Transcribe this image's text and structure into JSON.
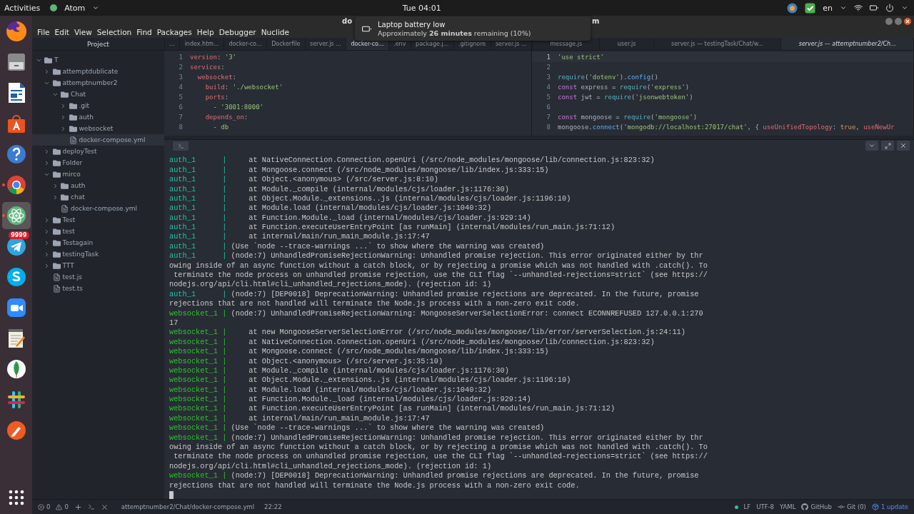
{
  "top_bar": {
    "activities": "Activities",
    "app_menu": "Atom",
    "clock": "Tue 04:01",
    "language": "en"
  },
  "dock": [
    {
      "kind": "firefox",
      "selected": false,
      "running": false
    },
    {
      "kind": "files",
      "selected": false,
      "running": false
    },
    {
      "kind": "writer",
      "selected": false,
      "running": false
    },
    {
      "kind": "store",
      "selected": false,
      "running": false
    },
    {
      "kind": "help",
      "selected": false,
      "running": false
    },
    {
      "kind": "chrome",
      "selected": false,
      "running": true
    },
    {
      "kind": "atom",
      "selected": true,
      "running": true
    },
    {
      "kind": "telegram",
      "selected": false,
      "running": false,
      "badge": "9999"
    },
    {
      "kind": "skype",
      "selected": false,
      "running": false
    },
    {
      "kind": "zoom",
      "selected": false,
      "running": false
    },
    {
      "kind": "notes",
      "selected": false,
      "running": false
    },
    {
      "kind": "leaf",
      "selected": false,
      "running": false
    },
    {
      "kind": "slack",
      "selected": false,
      "running": false
    },
    {
      "kind": "pen",
      "selected": false,
      "running": false
    }
  ],
  "notification": {
    "title": "Laptop battery low",
    "body": "Approximately **26 minutes** remaining (10%)"
  },
  "window": {
    "title_left": "do",
    "title_right": "m"
  },
  "menu": [
    "File",
    "Edit",
    "View",
    "Selection",
    "Find",
    "Packages",
    "Help",
    "Debugger",
    "Nuclide"
  ],
  "tree": {
    "header": "Project",
    "items": [
      {
        "label": "T",
        "kind": "folder",
        "expanded": true,
        "selected": false,
        "children": [
          {
            "label": "attemptdublicate",
            "kind": "folder",
            "expanded": false,
            "selected": false
          },
          {
            "label": "attemptnumber2",
            "kind": "folder",
            "expanded": true,
            "selected": false,
            "children": [
              {
                "label": "Chat",
                "kind": "folder",
                "expanded": true,
                "selected": false,
                "children": [
                  {
                    "label": ".git",
                    "kind": "folder",
                    "expanded": false,
                    "selected": false
                  },
                  {
                    "label": "auth",
                    "kind": "folder",
                    "expanded": false,
                    "selected": false
                  },
                  {
                    "label": "websocket",
                    "kind": "folder",
                    "expanded": false,
                    "selected": false
                  },
                  {
                    "label": "docker-compose.yml",
                    "kind": "file",
                    "selected": true
                  }
                ]
              }
            ]
          },
          {
            "label": "deployTest",
            "kind": "folder",
            "expanded": false,
            "selected": false
          },
          {
            "label": "Folder",
            "kind": "folder",
            "expanded": false,
            "selected": false
          },
          {
            "label": "mirco",
            "kind": "folder",
            "expanded": true,
            "selected": false,
            "children": [
              {
                "label": "auth",
                "kind": "folder",
                "expanded": false,
                "selected": false
              },
              {
                "label": "chat",
                "kind": "folder",
                "expanded": false,
                "selected": false
              },
              {
                "label": "docker-compose.yml",
                "kind": "file",
                "selected": false
              }
            ]
          },
          {
            "label": "Test",
            "kind": "folder",
            "expanded": false,
            "selected": false
          },
          {
            "label": "test",
            "kind": "folder",
            "expanded": false,
            "selected": false
          },
          {
            "label": "Testagain",
            "kind": "folder",
            "expanded": false,
            "selected": false
          },
          {
            "label": "testingTask",
            "kind": "folder",
            "expanded": false,
            "selected": false
          },
          {
            "label": "TTT",
            "kind": "folder",
            "expanded": false,
            "selected": false
          },
          {
            "label": "test.js",
            "kind": "file",
            "selected": false
          },
          {
            "label": "test.ts",
            "kind": "file",
            "selected": false
          }
        ]
      }
    ]
  },
  "panes": [
    {
      "tabs": [
        {
          "label": "...",
          "selected": false,
          "preview": false
        },
        {
          "label": "index.htm...",
          "selected": false,
          "preview": false
        },
        {
          "label": "docker-co...",
          "selected": false,
          "preview": false
        },
        {
          "label": "Dockerfile",
          "selected": false,
          "preview": false
        },
        {
          "label": "server.js ...",
          "selected": false,
          "preview": false
        },
        {
          "label": "docker-co...",
          "selected": true,
          "preview": false
        },
        {
          "label": ".env",
          "selected": false,
          "preview": false
        },
        {
          "label": "package.j...",
          "selected": false,
          "preview": false
        },
        {
          "label": ".gitignore",
          "selected": false,
          "preview": false
        },
        {
          "label": "server.js ...",
          "selected": false,
          "preview": false
        }
      ],
      "lines": [
        {
          "number": "1",
          "selected": false,
          "tokens": [
            {
              "kind": "key",
              "t": "version"
            },
            {
              "kind": "punct",
              "t": ": "
            },
            {
              "kind": "str",
              "t": "'3'"
            }
          ]
        },
        {
          "number": "2",
          "selected": false,
          "tokens": [
            {
              "kind": "key",
              "t": "services"
            },
            {
              "kind": "punct",
              "t": ":"
            }
          ]
        },
        {
          "number": "3",
          "selected": false,
          "tokens": [
            {
              "kind": "key",
              "t": "  websocket"
            },
            {
              "kind": "punct",
              "t": ":"
            }
          ]
        },
        {
          "number": "4",
          "selected": false,
          "tokens": [
            {
              "kind": "key",
              "t": "    build"
            },
            {
              "kind": "punct",
              "t": ": "
            },
            {
              "kind": "str",
              "t": "'./websocket'"
            }
          ]
        },
        {
          "number": "5",
          "selected": false,
          "tokens": [
            {
              "kind": "key",
              "t": "    ports"
            },
            {
              "kind": "punct",
              "t": ":"
            }
          ]
        },
        {
          "number": "6",
          "selected": false,
          "tokens": [
            {
              "kind": "punct",
              "t": "      - "
            },
            {
              "kind": "str",
              "t": "'3001:8000'"
            }
          ]
        },
        {
          "number": "7",
          "selected": false,
          "tokens": [
            {
              "kind": "key",
              "t": "    depends_on"
            },
            {
              "kind": "punct",
              "t": ":"
            }
          ]
        },
        {
          "number": "8",
          "selected": false,
          "tokens": [
            {
              "kind": "punct",
              "t": "      - "
            },
            {
              "kind": "str",
              "t": "db"
            }
          ]
        }
      ]
    },
    {
      "tabs": [
        {
          "label": "message.js",
          "selected": false,
          "preview": false
        },
        {
          "label": "user.js",
          "selected": false,
          "preview": false
        },
        {
          "label": "server.js — testingTask/Chat/w...",
          "selected": false,
          "preview": false
        },
        {
          "label": "server.js — attemptnumber2/Ch...",
          "selected": true,
          "preview": true
        }
      ],
      "lines": [
        {
          "number": "1",
          "selected": true,
          "tokens": [
            {
              "kind": "str",
              "t": "'use strict'"
            }
          ]
        },
        {
          "number": "2",
          "selected": false
        },
        {
          "number": "3",
          "selected": false,
          "tokens": [
            {
              "kind": "fn",
              "t": "require"
            },
            {
              "kind": "punct",
              "t": "("
            },
            {
              "kind": "str",
              "t": "'dotenv'"
            },
            {
              "kind": "punct",
              "t": ")."
            },
            {
              "kind": "call",
              "t": "config"
            },
            {
              "kind": "punct",
              "t": "()"
            }
          ]
        },
        {
          "number": "4",
          "selected": false,
          "tokens": [
            {
              "kind": "kw",
              "t": "const "
            },
            {
              "kind": "punct",
              "t": "express = "
            },
            {
              "kind": "fn",
              "t": "require"
            },
            {
              "kind": "punct",
              "t": "("
            },
            {
              "kind": "str",
              "t": "'express'"
            },
            {
              "kind": "punct",
              "t": ")"
            }
          ]
        },
        {
          "number": "5",
          "selected": false,
          "tokens": [
            {
              "kind": "kw",
              "t": "const "
            },
            {
              "kind": "punct",
              "t": "jwt = "
            },
            {
              "kind": "fn",
              "t": "require"
            },
            {
              "kind": "punct",
              "t": "("
            },
            {
              "kind": "str",
              "t": "'jsonwebtoken'"
            },
            {
              "kind": "punct",
              "t": ")"
            }
          ]
        },
        {
          "number": "6",
          "selected": false
        },
        {
          "number": "7",
          "selected": false,
          "tokens": [
            {
              "kind": "kw",
              "t": "const "
            },
            {
              "kind": "punct",
              "t": "mongoose = "
            },
            {
              "kind": "fn",
              "t": "require"
            },
            {
              "kind": "punct",
              "t": "("
            },
            {
              "kind": "str",
              "t": "'mongoose'"
            },
            {
              "kind": "punct",
              "t": ")"
            }
          ]
        },
        {
          "number": "8",
          "selected": false,
          "tokens": [
            {
              "kind": "punct",
              "t": "mongoose."
            },
            {
              "kind": "call",
              "t": "connect"
            },
            {
              "kind": "punct",
              "t": "("
            },
            {
              "kind": "str",
              "t": "'mongodb://localhost:27017/chat'"
            },
            {
              "kind": "punct",
              "t": ", { "
            },
            {
              "kind": "key",
              "t": "useUnifiedTopology"
            },
            {
              "kind": "punct",
              "t": ": "
            },
            {
              "kind": "bool",
              "t": "true"
            },
            {
              "kind": "punct",
              "t": ", "
            },
            {
              "kind": "key",
              "t": "useNewUr"
            }
          ]
        }
      ]
    }
  ],
  "terminal": {
    "lines": [
      {
        "prefix": "auth_1      |",
        "color": "#1fc2a6",
        "text": "     at NativeConnection.Connection.openUri (/src/node_modules/mongoose/lib/connection.js:823:32)"
      },
      {
        "prefix": "auth_1      |",
        "color": "#1fc2a6",
        "text": "     at Mongoose.connect (/src/node_modules/mongoose/lib/index.js:333:15)"
      },
      {
        "prefix": "auth_1      |",
        "color": "#1fc2a6",
        "text": "     at Object.<anonymous> (/src/server.js:8:10)"
      },
      {
        "prefix": "auth_1      |",
        "color": "#1fc2a6",
        "text": "     at Module._compile (internal/modules/cjs/loader.js:1176:30)"
      },
      {
        "prefix": "auth_1      |",
        "color": "#1fc2a6",
        "text": "     at Object.Module._extensions..js (internal/modules/cjs/loader.js:1196:10)"
      },
      {
        "prefix": "auth_1      |",
        "color": "#1fc2a6",
        "text": "     at Module.load (internal/modules/cjs/loader.js:1040:32)"
      },
      {
        "prefix": "auth_1      |",
        "color": "#1fc2a6",
        "text": "     at Function.Module._load (internal/modules/cjs/loader.js:929:14)"
      },
      {
        "prefix": "auth_1      |",
        "color": "#1fc2a6",
        "text": "     at Function.executeUserEntryPoint [as runMain] (internal/modules/run_main.js:71:12)"
      },
      {
        "prefix": "auth_1      |",
        "color": "#1fc2a6",
        "text": "     at internal/main/run_main_module.js:17:47"
      },
      {
        "prefix": "auth_1      |",
        "color": "#1fc2a6",
        "text": " (Use `node --trace-warnings ...` to show where the warning was created)"
      },
      {
        "prefix": "auth_1      |",
        "color": "#1fc2a6",
        "text": " (node:7) UnhandledPromiseRejectionWarning: Unhandled promise rejection. This error originated either by thr"
      },
      {
        "text": "owing inside of an async function without a catch block, or by rejecting a promise which was not handled with .catch(). To"
      },
      {
        "text": " terminate the node process on unhandled promise rejection, use the CLI flag `--unhandled-rejections=strict` (see https://"
      },
      {
        "text": "nodejs.org/api/cli.html#cli_unhandled_rejections_mode). (rejection id: 1)"
      },
      {
        "prefix": "auth_1      |",
        "color": "#1fc2a6",
        "text": " (node:7) [DEP0018] DeprecationWarning: Unhandled promise rejections are deprecated. In the future, promise"
      },
      {
        "text": "rejections that are not handled will terminate the Node.js process with a non-zero exit code."
      },
      {
        "prefix": "websocket_1 |",
        "color": "#2bc42b",
        "text": " (node:7) UnhandledPromiseRejectionWarning: MongooseServerSelectionError: connect ECONNREFUSED 127.0.0.1:270"
      },
      {
        "text": "17"
      },
      {
        "prefix": "websocket_1 |",
        "color": "#2bc42b",
        "text": "     at new MongooseServerSelectionError (/src/node_modules/mongoose/lib/error/serverSelection.js:24:11)"
      },
      {
        "prefix": "websocket_1 |",
        "color": "#2bc42b",
        "text": "     at NativeConnection.Connection.openUri (/src/node_modules/mongoose/lib/connection.js:823:32)"
      },
      {
        "prefix": "websocket_1 |",
        "color": "#2bc42b",
        "text": "     at Mongoose.connect (/src/node_modules/mongoose/lib/index.js:333:15)"
      },
      {
        "prefix": "websocket_1 |",
        "color": "#2bc42b",
        "text": "     at Object.<anonymous> (/src/server.js:35:10)"
      },
      {
        "prefix": "websocket_1 |",
        "color": "#2bc42b",
        "text": "     at Module._compile (internal/modules/cjs/loader.js:1176:30)"
      },
      {
        "prefix": "websocket_1 |",
        "color": "#2bc42b",
        "text": "     at Object.Module._extensions..js (internal/modules/cjs/loader.js:1196:10)"
      },
      {
        "prefix": "websocket_1 |",
        "color": "#2bc42b",
        "text": "     at Module.load (internal/modules/cjs/loader.js:1040:32)"
      },
      {
        "prefix": "websocket_1 |",
        "color": "#2bc42b",
        "text": "     at Function.Module._load (internal/modules/cjs/loader.js:929:14)"
      },
      {
        "prefix": "websocket_1 |",
        "color": "#2bc42b",
        "text": "     at Function.executeUserEntryPoint [as runMain] (internal/modules/run_main.js:71:12)"
      },
      {
        "prefix": "websocket_1 |",
        "color": "#2bc42b",
        "text": "     at internal/main/run_main_module.js:17:47"
      },
      {
        "prefix": "websocket_1 |",
        "color": "#2bc42b",
        "text": " (Use `node --trace-warnings ...` to show where the warning was created)"
      },
      {
        "prefix": "websocket_1 |",
        "color": "#2bc42b",
        "text": " (node:7) UnhandledPromiseRejectionWarning: Unhandled promise rejection. This error originated either by thr"
      },
      {
        "text": "owing inside of an async function without a catch block, or by rejecting a promise which was not handled with .catch(). To"
      },
      {
        "text": " terminate the node process on unhandled promise rejection, use the CLI flag `--unhandled-rejections=strict` (see https://"
      },
      {
        "text": "nodejs.org/api/cli.html#cli_unhandled_rejections_mode). (rejection id: 1)"
      },
      {
        "prefix": "websocket_1 |",
        "color": "#2bc42b",
        "text": " (node:7) [DEP0018] DeprecationWarning: Unhandled promise rejections are deprecated. In the future, promise"
      },
      {
        "text": "rejections that are not handled will terminate the Node.js process with a non-zero exit code."
      }
    ]
  },
  "status_bar": {
    "errors": "0",
    "warnings": "0",
    "path": "attemptnumber2/Chat/docker-compose.yml",
    "cursor": "22:22",
    "line_ending": "LF",
    "encoding": "UTF-8",
    "grammar": "YAML",
    "github": "GitHub",
    "git": "Git (0)",
    "update": "1 update"
  }
}
